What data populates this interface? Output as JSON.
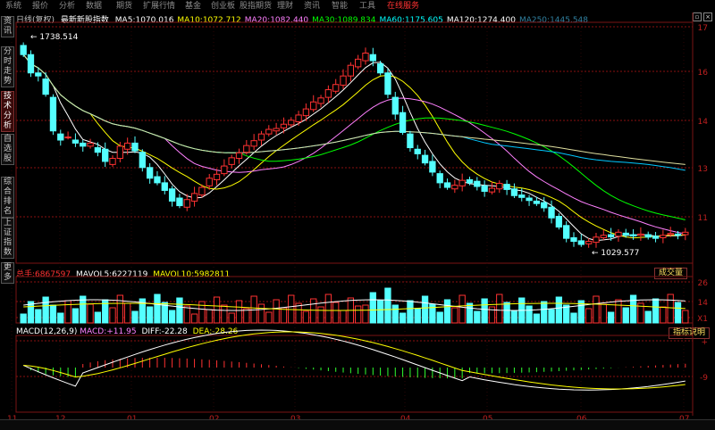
{
  "menu": {
    "items": [
      "系统",
      "报价",
      "分析",
      "数据",
      "期货",
      "扩展行情",
      "基金",
      "创业板",
      "股指期货",
      "理财",
      "资讯",
      "智能",
      "工具",
      "在线服务"
    ],
    "active_index": 13
  },
  "side_tabs": [
    "资讯",
    "分时走势",
    "技术分析",
    "自选股",
    "综合排名",
    "上证指数",
    "更多"
  ],
  "side_tab_active": 2,
  "price_header": {
    "chart_name": "日线(复权)",
    "indicator_name": "最新新股指数",
    "ma": [
      {
        "label": "MA5:",
        "value": "1070.016",
        "color": "#ffffff"
      },
      {
        "label": "MA10:",
        "value": "1072.712",
        "color": "#ffff00"
      },
      {
        "label": "MA20:",
        "value": "1082.440",
        "color": "#ff80ff"
      },
      {
        "label": "MA30:",
        "value": "1089.834",
        "color": "#00ff00"
      },
      {
        "label": "MA60:",
        "value": "1175.605",
        "color": "#00ffff"
      },
      {
        "label": "MA120:",
        "value": "1274.400",
        "color": "#ffffff"
      },
      {
        "label": "MA250:",
        "value": "1445.548",
        "color": "#3080a0"
      }
    ]
  },
  "high_label": "1738.514",
  "low_label": "1029.577",
  "price_axis": [
    "17",
    "16",
    "14",
    "13",
    "11"
  ],
  "volume_header": {
    "total_label": "总手:",
    "total_value": "6867597",
    "mavol5_label": "MAVOL5:",
    "mavol5_value": "6227119",
    "mavol10_label": "MAVOL10:",
    "mavol10_value": "5982811"
  },
  "volume_button": "成交量",
  "volume_axis": [
    "26",
    "14",
    "X1"
  ],
  "macd_header": {
    "name": "MACD(12,26,9)",
    "macd_label": "MACD:",
    "macd_value": "+11.95",
    "diff_label": "DIFF:",
    "diff_value": "-22.28",
    "dea_label": "DEA:",
    "dea_value": "-28.26"
  },
  "macd_button": "指标说明",
  "macd_axis": [
    "+",
    "-9"
  ],
  "x_axis": [
    "11",
    "12",
    "01",
    "02",
    "03",
    "04",
    "05",
    "06",
    "07"
  ],
  "colors": {
    "up": "#ff3232",
    "down": "#54ffff",
    "grid": "#8a1010",
    "axis_text": "#c02020",
    "menu_active": "#ff3232"
  },
  "chart_data": {
    "type": "candlestick",
    "price": {
      "open": [
        1690,
        1660,
        1600,
        1580,
        1520,
        1400,
        1390,
        1380,
        1370,
        1360,
        1355,
        1350,
        1300,
        1320,
        1350,
        1370,
        1340,
        1290,
        1260,
        1240,
        1220,
        1190,
        1160,
        1180,
        1200,
        1230,
        1250,
        1270,
        1300,
        1320,
        1340,
        1360,
        1380,
        1400,
        1410,
        1420,
        1430,
        1440,
        1460,
        1480,
        1500,
        1520,
        1540,
        1560,
        1590,
        1620,
        1640,
        1660,
        1630,
        1600,
        1520,
        1470,
        1400,
        1350,
        1330,
        1310,
        1270,
        1240,
        1220,
        1230,
        1250,
        1245,
        1230,
        1210,
        1220,
        1235,
        1220,
        1200,
        1190,
        1180,
        1175,
        1160,
        1130,
        1100,
        1060,
        1050,
        1040,
        1045,
        1060,
        1070,
        1065,
        1075,
        1070,
        1068,
        1070,
        1065,
        1060,
        1070,
        1072,
        1070
      ],
      "close": [
        1660,
        1600,
        1590,
        1530,
        1410,
        1380,
        1390,
        1370,
        1360,
        1370,
        1340,
        1310,
        1320,
        1360,
        1370,
        1345,
        1290,
        1255,
        1240,
        1215,
        1180,
        1165,
        1185,
        1205,
        1225,
        1255,
        1268,
        1295,
        1322,
        1338,
        1362,
        1378,
        1400,
        1415,
        1418,
        1432,
        1445,
        1462,
        1482,
        1505,
        1518,
        1545,
        1562,
        1590,
        1625,
        1645,
        1665,
        1640,
        1600,
        1530,
        1465,
        1405,
        1355,
        1335,
        1305,
        1275,
        1240,
        1225,
        1232,
        1248,
        1240,
        1228,
        1212,
        1222,
        1238,
        1218,
        1198,
        1192,
        1182,
        1172,
        1158,
        1125,
        1095,
        1058,
        1048,
        1038,
        1048,
        1062,
        1068,
        1063,
        1078,
        1068,
        1066,
        1072,
        1062,
        1058,
        1068,
        1074,
        1068,
        1078
      ]
    },
    "x_ticks": [
      "11",
      "12",
      "01",
      "02",
      "03",
      "04",
      "05",
      "06",
      "07"
    ]
  }
}
